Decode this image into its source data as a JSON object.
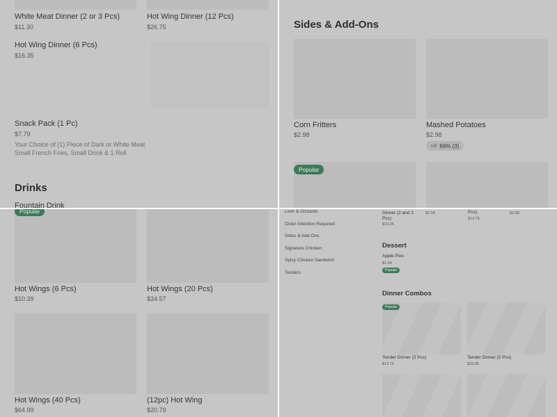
{
  "q1": {
    "items": [
      {
        "name": "White Meat Dinner (2 or 3 Pcs)",
        "price": "$11.30"
      },
      {
        "name": "Hot Wing Dinner (12 Pcs)",
        "price": "$26.75"
      },
      {
        "name": "Hot Wing Dinner (6 Pcs)",
        "price": "$16.35"
      },
      {
        "name": "Snack Pack (1 Pc)",
        "price": "$7.79",
        "desc1": "Your Choice of (1) Piece of Dark or White Meat",
        "desc2": "Small French Fries, Small Drink & 1 Roll"
      }
    ],
    "section_title": "Drinks",
    "partial_item": "Fountain Drink"
  },
  "q2": {
    "section_title": "Sides & Add-Ons",
    "items": [
      {
        "name": "Corn Fritters",
        "price": "$2.98"
      },
      {
        "name": "Mashed Potatoes",
        "price": "$2.98",
        "rating": "66% (3)"
      }
    ],
    "badge": "Popular"
  },
  "q3": {
    "badge": "Popular",
    "items": [
      {
        "name": "Hot Wings (6 Pcs)",
        "price": "$10.39"
      },
      {
        "name": "Hot Wings (20 Pcs)",
        "price": "$34.57"
      },
      {
        "name": "Hot Wings (40 Pcs)",
        "price": "$64.99"
      },
      {
        "name": "(12pc) Hot Wing",
        "price": "$20.79"
      }
    ]
  },
  "q4": {
    "nav": [
      "Liver & Gizzards",
      "Order Attention Required",
      "Sides & Add-Ons",
      "Signature Chicken",
      "Spicy Chicken Sandwich",
      "Tenders"
    ],
    "top_items": [
      {
        "name1": "Dinner (2 and 3",
        "name2": "Pcs)",
        "price": "$10.26"
      },
      {
        "name1": "",
        "name2": "",
        "price": "$2.98"
      },
      {
        "name1": "Pcs)",
        "name2": "",
        "price": "$13.75"
      },
      {
        "name1": "",
        "name2": "",
        "price": "$2.98"
      }
    ],
    "dessert": {
      "title": "Dessert",
      "name": "Apple Pies",
      "price": "$1.94",
      "badge": "Popular"
    },
    "combos": {
      "title": "Dinner Combos",
      "badge": "Popular",
      "items": [
        {
          "name": "Tender Dinner (3 Pcs)",
          "price": "$13.75"
        },
        {
          "name": "Tender Dinner (5 Pcs)",
          "price": "$28.95"
        }
      ]
    }
  },
  "colors": {
    "background": "#c6c6c6",
    "divider": "#ffffff",
    "badge": "#3c7a58"
  }
}
